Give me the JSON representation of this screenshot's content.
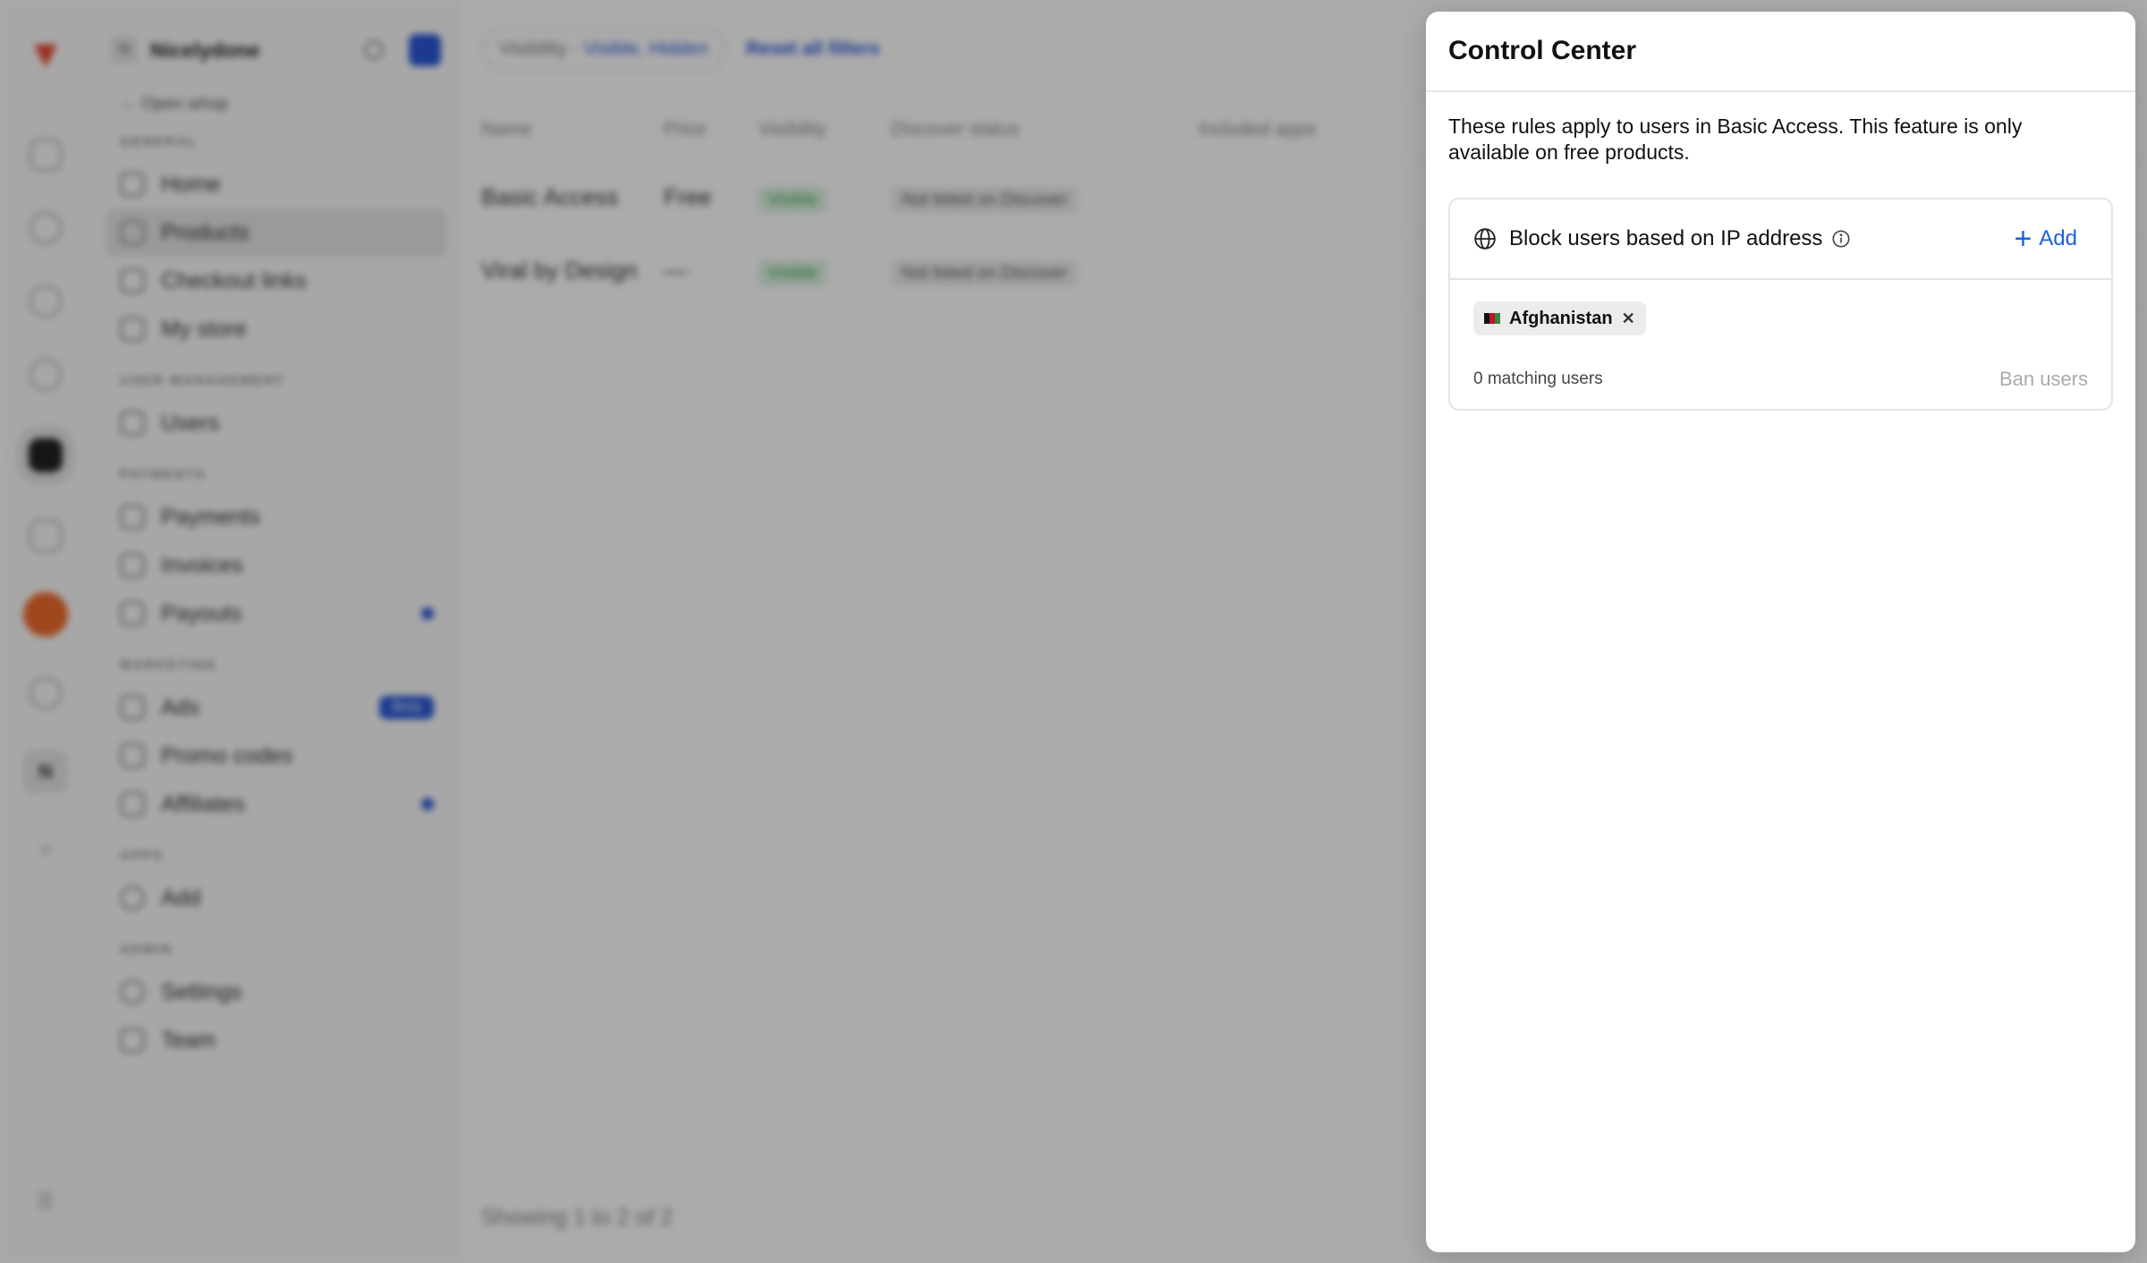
{
  "background": {
    "workspace_name": "Nicelydone",
    "back_label": "Open whop",
    "sections": {
      "general": "GENERAL",
      "user_management": "USER MANAGEMENT",
      "payments": "PAYMENTS",
      "marketing": "MARKETING",
      "apps": "APPS",
      "admin": "ADMIN"
    },
    "nav": {
      "home": "Home",
      "products": "Products",
      "checkout_links": "Checkout links",
      "my_store": "My store",
      "users": "Users",
      "payments": "Payments",
      "invoices": "Invoices",
      "payouts": "Payouts",
      "ads": "Ads",
      "ads_badge": "Beta",
      "promo_codes": "Promo codes",
      "affiliates": "Affiliates",
      "add": "Add",
      "settings": "Settings",
      "team": "Team"
    },
    "rail_badge": "N",
    "filters": {
      "visibility_label": "Visibility · ",
      "visibility_value": "Visible, Hidden",
      "reset": "Reset all filters"
    },
    "table": {
      "headers": [
        "Name",
        "Price",
        "Visibility",
        "Discover status",
        "Included apps"
      ],
      "rows": [
        {
          "name": "Basic Access",
          "price": "Free",
          "visibility": "Visible",
          "discover": "Not listed on Discover"
        },
        {
          "name": "Viral by Design",
          "price": "—",
          "visibility": "Visible",
          "discover": "Not listed on Discover"
        }
      ]
    },
    "showing": "Showing 1 to 2 of 2"
  },
  "panel": {
    "title": "Control Center",
    "description": "These rules apply to users in Basic Access. This feature is only available on free products.",
    "rule": {
      "title": "Block users based on IP address",
      "add_label": "Add",
      "tags": [
        {
          "label": "Afghanistan"
        }
      ],
      "matching": "0 matching users",
      "ban_label": "Ban users"
    }
  },
  "colors": {
    "accent": "#1e5fe0",
    "disabled_text": "#aaaaaa",
    "overlay": "rgba(0,0,0,0.33)"
  }
}
